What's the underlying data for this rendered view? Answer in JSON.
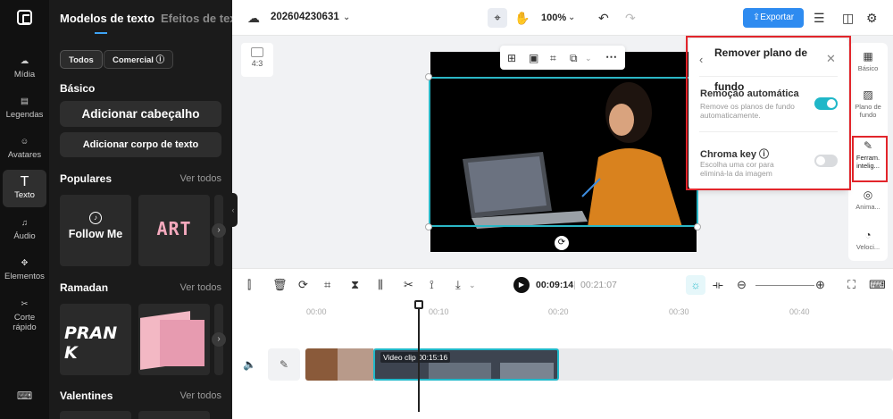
{
  "rail": {
    "items": [
      {
        "label": "Mídia",
        "icon": "cloud-upload-icon",
        "glyph": "☁"
      },
      {
        "label": "Legendas",
        "icon": "captions-icon",
        "glyph": "▤"
      },
      {
        "label": "Avatares",
        "icon": "avatar-icon",
        "glyph": "☺"
      },
      {
        "label": "Texto",
        "icon": "text-icon",
        "glyph": "T"
      },
      {
        "label": "Áudio",
        "icon": "music-icon",
        "glyph": "♫"
      },
      {
        "label": "Elementos",
        "icon": "elements-icon",
        "glyph": "✥"
      },
      {
        "label": "Corte rápido",
        "icon": "quick-cut-icon",
        "glyph": "✂"
      }
    ],
    "active": "Texto"
  },
  "panel": {
    "tabs": [
      "Modelos de texto",
      "Efeitos de texto"
    ],
    "chips": [
      "Todos",
      "Comercial ⓘ"
    ],
    "basic": {
      "title": "Básico",
      "add_heading": "Adicionar cabeçalho",
      "add_body": "Adicionar corpo de texto"
    },
    "sections": [
      {
        "title": "Populares",
        "see_all": "Ver todos",
        "cards": [
          "Follow Me",
          "ART"
        ]
      },
      {
        "title": "Ramadan",
        "see_all": "Ver todos",
        "cards": [
          "PRAN K"
        ]
      },
      {
        "title": "Valentines",
        "see_all": "Ver todos"
      }
    ]
  },
  "header": {
    "project_name": "202604230631",
    "zoom": "100%",
    "export_label": "Exportar",
    "accent": "#2e8bf0"
  },
  "canvas": {
    "ratio": "4:3"
  },
  "right_rail": {
    "items": [
      {
        "label": "Básico",
        "icon": "film-icon",
        "glyph": "▦"
      },
      {
        "label": "Plano de fundo",
        "icon": "background-icon",
        "glyph": "▨"
      },
      {
        "label": "Ferram. intelig...",
        "icon": "magic-wand-icon",
        "glyph": "✎"
      },
      {
        "label": "Anima...",
        "icon": "animation-icon",
        "glyph": "◎"
      },
      {
        "label": "Veloci...",
        "icon": "speed-icon",
        "glyph": "◔"
      }
    ]
  },
  "popup": {
    "title": "Remover plano de fundo",
    "auto": {
      "title": "Remoção automática",
      "desc": "Remove os planos de fundo automaticamente.",
      "enabled": true
    },
    "chroma": {
      "title": "Chroma key ⓘ",
      "desc": "Escolha uma cor para eliminá-la da imagem",
      "enabled": false
    }
  },
  "playback": {
    "current": "00:09:14",
    "separator": "|",
    "total": "00:21:07"
  },
  "ruler": [
    "00:00",
    "00:10",
    "00:20",
    "00:30",
    "00:40"
  ],
  "clip": {
    "label": "Video clip",
    "duration": "00:15:16"
  }
}
